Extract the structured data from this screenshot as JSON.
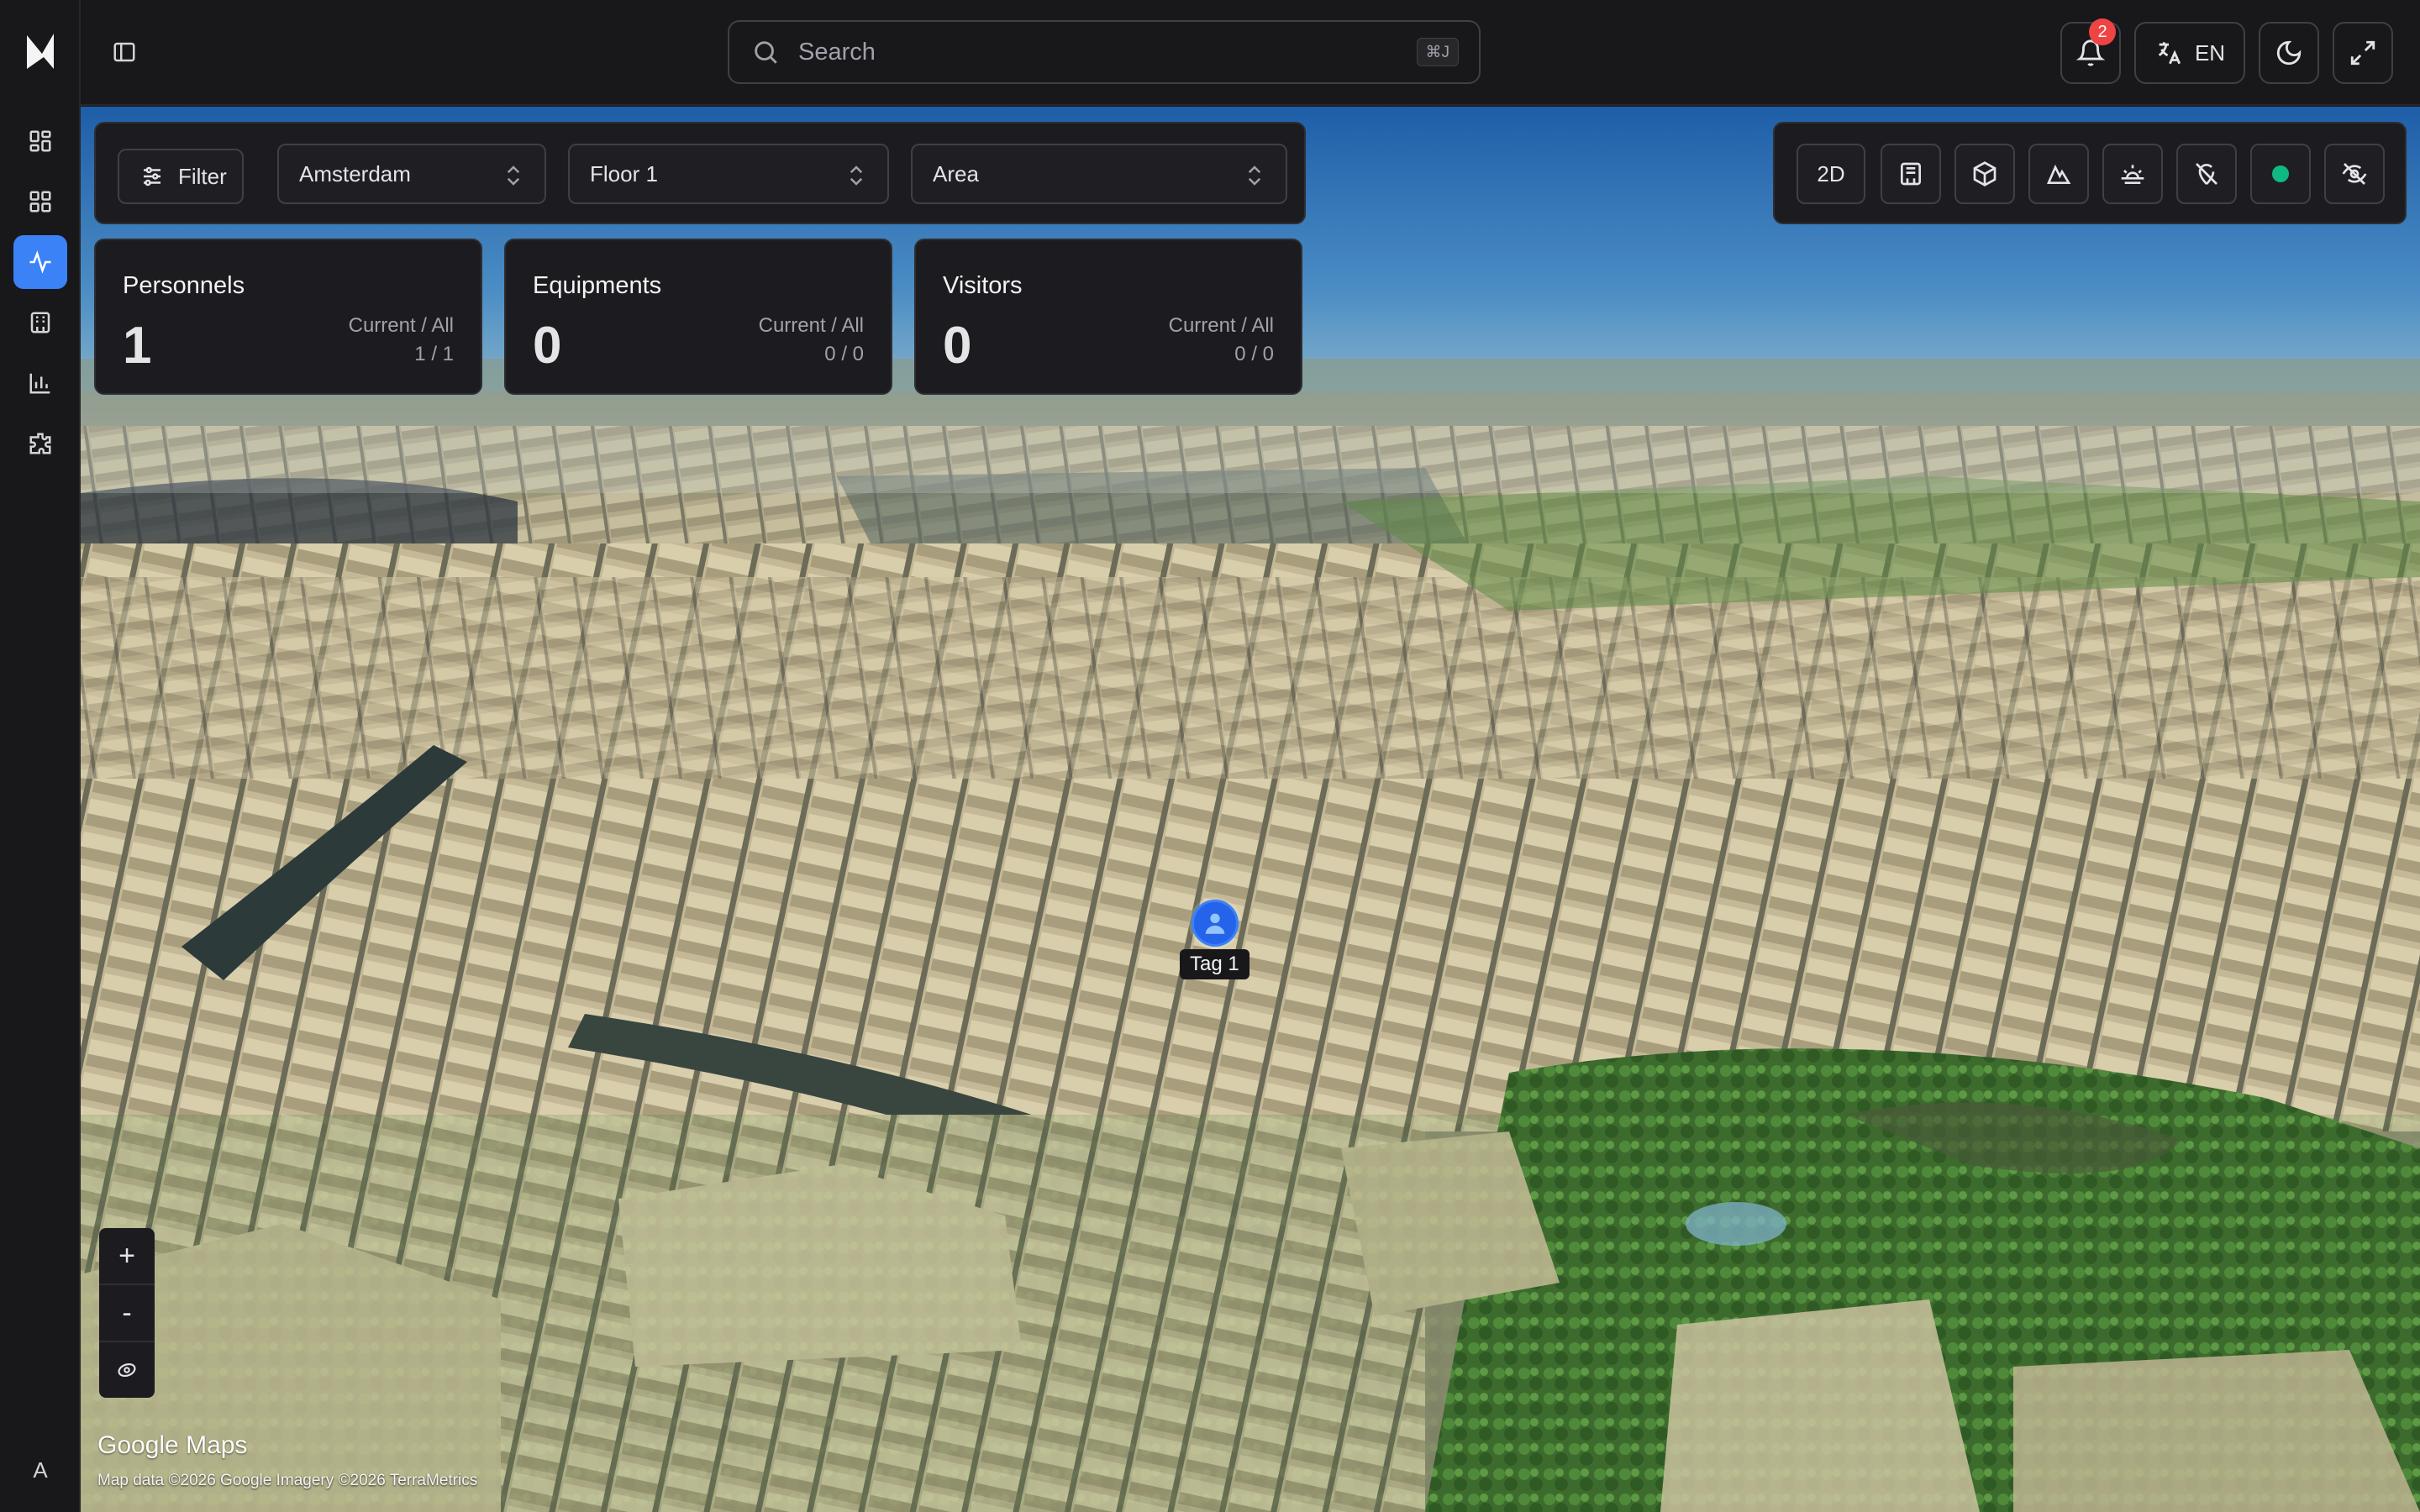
{
  "header": {
    "search_placeholder": "Search",
    "search_shortcut": "⌘J",
    "notification_count": "2",
    "language": "EN"
  },
  "sidebar": {
    "items": [
      {
        "name": "dashboard",
        "icon": "layout-dashboard-icon"
      },
      {
        "name": "grid",
        "icon": "grid-icon"
      },
      {
        "name": "activity",
        "icon": "activity-icon",
        "active": true
      },
      {
        "name": "buildings",
        "icon": "building-icon"
      },
      {
        "name": "analytics",
        "icon": "bar-chart-icon"
      },
      {
        "name": "plugins",
        "icon": "puzzle-icon"
      }
    ],
    "user_initial": "A",
    "active_color": "#3b82f6"
  },
  "filters": {
    "filter_label": "Filter",
    "city": "Amsterdam",
    "floor": "Floor 1",
    "area": "Area"
  },
  "stats": [
    {
      "title": "Personnels",
      "value": "1",
      "sub": "Current / All",
      "ratio": "1 / 1"
    },
    {
      "title": "Equipments",
      "value": "0",
      "sub": "Current / All",
      "ratio": "0 / 0"
    },
    {
      "title": "Visitors",
      "value": "0",
      "sub": "Current / All",
      "ratio": "0 / 0"
    }
  ],
  "toolbar": {
    "mode_label": "2D",
    "status_color": "#10b981"
  },
  "map": {
    "tag_label": "Tag 1",
    "zoom_in": "+",
    "zoom_out": "-",
    "provider": "Google Maps",
    "attribution": "Map data ©2026 Google  Imagery ©2026 TerraMetrics"
  }
}
